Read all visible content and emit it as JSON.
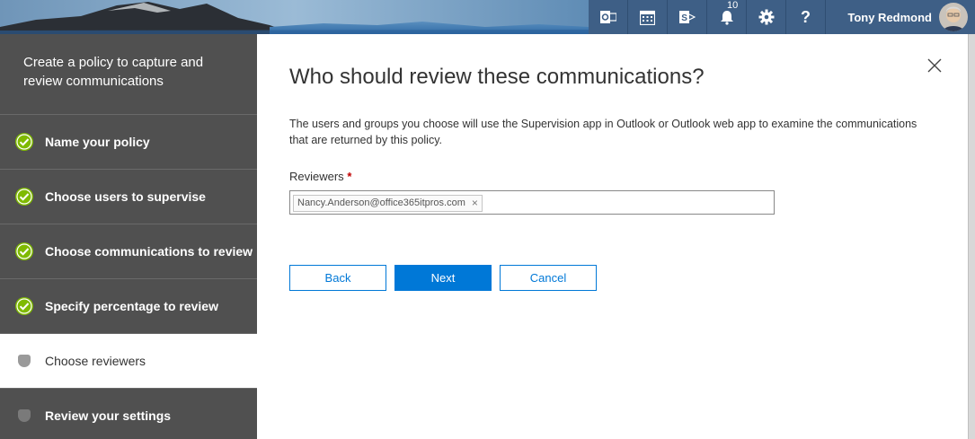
{
  "header": {
    "notification_count": "10",
    "user_name": "Tony Redmond",
    "icons": [
      "outlook-icon",
      "calendar-icon",
      "sharepoint-icon",
      "bell-icon",
      "gear-icon",
      "help-icon"
    ],
    "help_glyph": "?"
  },
  "sidebar": {
    "title": "Create a policy to capture and review communications",
    "steps": [
      {
        "label": "Name your policy",
        "state": "done"
      },
      {
        "label": "Choose users to supervise",
        "state": "done"
      },
      {
        "label": "Choose communications to review",
        "state": "done"
      },
      {
        "label": "Specify percentage to review",
        "state": "done"
      },
      {
        "label": "Choose reviewers",
        "state": "current"
      },
      {
        "label": "Review your settings",
        "state": "pending"
      }
    ]
  },
  "main": {
    "heading": "Who should review these communications?",
    "description": "The users and groups you choose will use the Supervision app in Outlook or Outlook web app to examine the communications that are returned by this policy.",
    "reviewers_label": "Reviewers",
    "required_mark": "*",
    "reviewers": [
      "Nancy.Anderson@office365itpros.com"
    ],
    "chip_remove": "×",
    "buttons": {
      "back": "Back",
      "next": "Next",
      "cancel": "Cancel"
    }
  },
  "colors": {
    "accent": "#0078d7",
    "sidebar_bg": "#505050",
    "suite_bar": "#3e5f86",
    "check_green": "#7fba00"
  }
}
